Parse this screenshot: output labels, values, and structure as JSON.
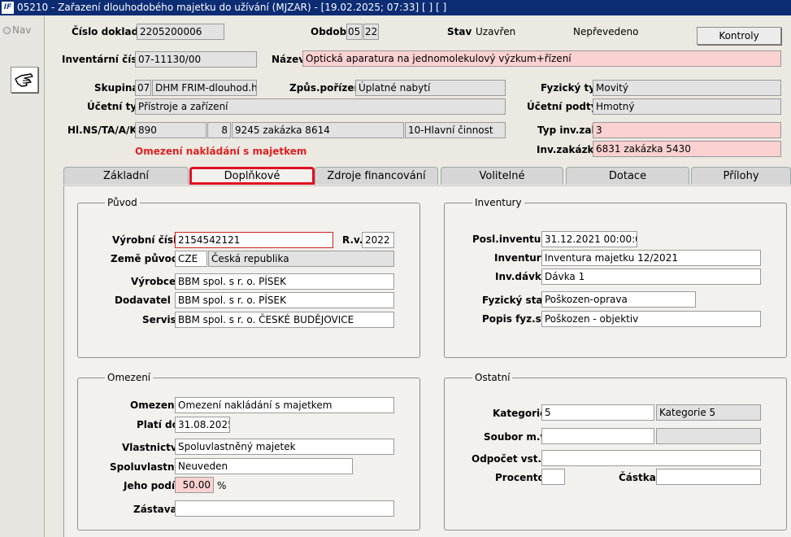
{
  "window": {
    "logo": "IF",
    "title": "05210 - Zařazení dlouhodobého majetku do užívání (MJZAR) - [19.02.2025; 07:33]  [ ]  [ ]"
  },
  "nav": {
    "label": "Nav"
  },
  "header": {
    "cislo_dokladu_label": "Číslo dokladu",
    "cislo_dokladu": "2205200006",
    "obdobi_label": "Období",
    "obdobi_1": "05",
    "obdobi_2": "22",
    "stav_label": "Stav",
    "stav": "Uzavřen",
    "stav2": "Nepřevedeno",
    "kontroly_label": "Kontroly",
    "inventarni_cislo_label": "Inventární číslo",
    "inventarni_cislo": "07-11130/00",
    "nazev_label": "Název",
    "nazev": "Optická aparatura na jednomolekulový výzkum+řízení",
    "skupina_label": "Skupina",
    "skupina_code": "07",
    "skupina_name": "DHM FRIM-dlouhod.hm",
    "zpus_label": "Způs.pořízení",
    "zpus": "Úplatné nabytí",
    "fyz_typ_label": "Fyzický typ",
    "fyz_typ": "Movitý",
    "ucetni_typ_label": "Účetní typ",
    "ucetni_typ": "Přístroje a zařízení",
    "ucetni_podtyp_label": "Účetní podtyp",
    "ucetni_podtyp": "Hmotný",
    "hl_label": "Hl.NS/TA/A/KP",
    "hl_1": "890",
    "hl_2": "8",
    "hl_3": "9245 zakázka 8614",
    "hl_4": "10-Hlavní činnost",
    "typ_inv_label": "Typ inv.zak.",
    "typ_inv": "3",
    "omezeni_warning": "Omezení nakládání s majetkem",
    "inv_zakazka_label": "Inv.zakázka",
    "inv_zakazka": "6831 zakázka 5430"
  },
  "tabs": [
    {
      "label": "Základní"
    },
    {
      "label": "Doplňkové"
    },
    {
      "label": "Zdroje financování"
    },
    {
      "label": "Volitelné"
    },
    {
      "label": "Dotace"
    },
    {
      "label": "Přílohy"
    }
  ],
  "puvod": {
    "title": "Původ",
    "vyrobni_cislo_label": "Výrobní číslo",
    "vyrobni_cislo": "2154542121",
    "rv_label": "R.v.",
    "rv": "2022",
    "zeme_label": "Země původu",
    "zeme_code": "CZE",
    "zeme_name": "Česká republika",
    "vyrobce_label": "Výrobce",
    "vyrobce": "BBM spol. s r. o.  PÍSEK",
    "dodavatel_label": "Dodavatel",
    "dodavatel": "BBM spol. s r. o.  PÍSEK",
    "servis_label": "Servis",
    "servis": "BBM spol. s r. o.  ČESKÉ BUDĚJOVICE"
  },
  "inventury": {
    "title": "Inventury",
    "posl_label": "Posl.inventura",
    "posl": "31.12.2021 00:00:00",
    "inventura_label": "Inventura",
    "inventura": "Inventura majetku 12/2021",
    "davka_label": "Inv.dávka",
    "davka": "Dávka 1",
    "fyz_stav_label": "Fyzický stav",
    "fyz_stav": "Poškozen-oprava",
    "popis_label": "Popis fyz.st.",
    "popis": "Poškozen - objektiv"
  },
  "omezeni": {
    "title": "Omezení",
    "omezeni_label": "Omezení",
    "omezeni": "Omezení nakládání s majetkem",
    "plati_label": "Platí do",
    "plati": "31.08.2025",
    "vlastnictvi_label": "Vlastnictví",
    "vlastnictvi": "Spoluvlastněný majetek",
    "spolu_label": "Spoluvlastník",
    "spolu": "Neuveden",
    "podil_label": "Jeho podíl",
    "podil": "50.00",
    "podil_unit": "%",
    "zastava_label": "Zástava",
    "zastava": ""
  },
  "ostatni": {
    "title": "Ostatní",
    "kategorie_label": "Kategorie",
    "kategorie": "5",
    "kategorie_name": "Kategorie 5",
    "soubor_label": "Soubor m.v.",
    "soubor": "",
    "soubor2": "",
    "odpocet_label": "Odpočet vst.c.",
    "odpocet": "",
    "procento_label": "Procento",
    "procento": "",
    "castka_label": "Částka",
    "castka": ""
  }
}
